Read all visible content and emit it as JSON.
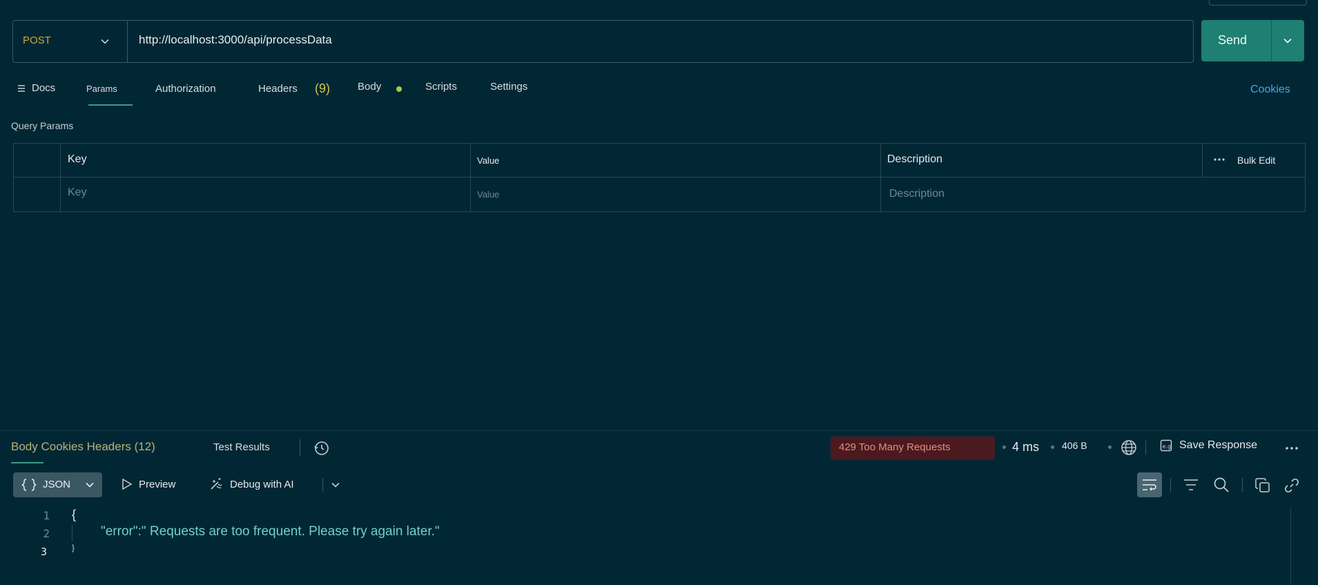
{
  "request": {
    "method": "POST",
    "url": "http://localhost:3000/api/processData",
    "send_label": "Send"
  },
  "tabs": {
    "docs": "Docs",
    "params": "Params",
    "authorization": "Authorization",
    "headers": "Headers",
    "headers_count": "(9)",
    "body": "Body",
    "scripts": "Scripts",
    "settings": "Settings",
    "cookies": "Cookies"
  },
  "query_params": {
    "title": "Query Params",
    "columns": {
      "key": "Key",
      "value": "Value",
      "description": "Description",
      "bulk_edit": "Bulk Edit"
    },
    "placeholders": {
      "key": "Key",
      "value": "Value",
      "description": "Description"
    }
  },
  "response": {
    "tabs_label": "Body Cookies Headers (12)",
    "test_results": "Test Results",
    "status": "429 Too Many Requests",
    "time": "4 ms",
    "size": "406 B",
    "save_response": "Save Response",
    "format": "JSON",
    "preview": "Preview",
    "debug_ai": "Debug with AI",
    "line_numbers": [
      "1",
      "2",
      "3"
    ],
    "code_line1": "{",
    "code_line2": "\"error\":\" Requests are too frequent. Please try again later.\"",
    "code_line3": "}"
  },
  "colors": {
    "background": "#022734",
    "accent": "#1e7f72",
    "method": "#d0a83a",
    "status_error": "#e88b7e",
    "link": "#4fa3e0"
  },
  "icons": [
    "chevron-down-icon",
    "hamburger-icon",
    "history-icon",
    "globe-icon",
    "save-icon",
    "more-icon",
    "braces-icon",
    "play-icon",
    "ai-icon",
    "wrap-icon",
    "filter-icon",
    "search-icon",
    "copy-icon",
    "link-icon"
  ]
}
